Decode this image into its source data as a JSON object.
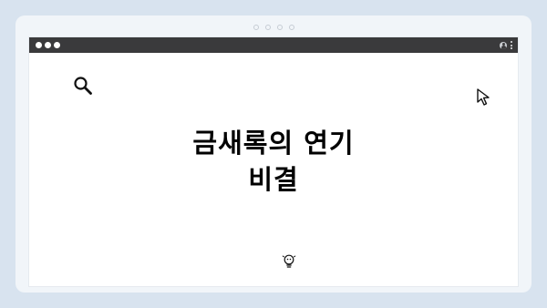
{
  "pager": {
    "count": 4
  },
  "titlebar": {
    "traffic_lights": [
      "close",
      "minimize",
      "maximize"
    ],
    "icons": [
      "profile-icon",
      "more-options-icon"
    ]
  },
  "content": {
    "title_line1": "금새록의 연기",
    "title_line2": "비결"
  },
  "icons": {
    "search": "search-icon",
    "cursor": "cursor-icon",
    "idea": "lightbulb-icon"
  },
  "colors": {
    "background": "#d8e3ef",
    "card": "#f1f5f9",
    "titlebar": "#3a3a3c",
    "window": "#ffffff",
    "text": "#000000"
  }
}
